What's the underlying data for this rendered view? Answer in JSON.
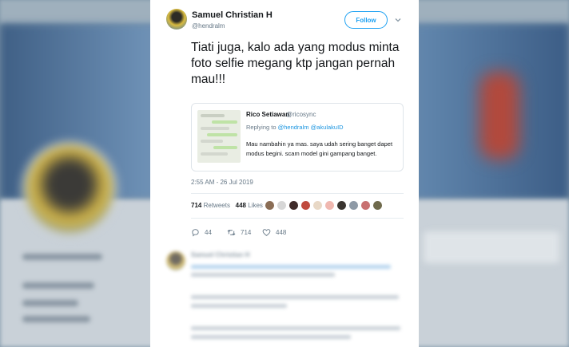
{
  "tweet": {
    "author_name": "Samuel Christian H",
    "author_handle": "@hendralm",
    "follow_label": "Follow",
    "text": "Tiati juga, kalo ada yang modus minta foto selfie megang ktp jangan pernah mau!!!",
    "timestamp": "2:55 AM - 26 Jul 2019",
    "retweets_count": "714",
    "retweets_label": "Retweets",
    "likes_count": "448",
    "likes_label": "Likes"
  },
  "quoted_tweet": {
    "name": "Rico Setiawan",
    "handle": "@ricosync",
    "replying_prefix": "Replying to",
    "mention_1": "@hendralm",
    "mention_2": "@akulakuID",
    "text": "Mau nambahin ya mas. saya udah sering banget dapet modus begini. scam model gini gampang banget."
  },
  "actions": {
    "replies": "44",
    "retweets": "714",
    "likes": "448"
  },
  "reply_preview": {
    "author_name": "Samuel Christian H"
  },
  "icons": {
    "reply": "reply-icon",
    "retweet": "retweet-icon",
    "like": "heart-icon",
    "more": "chevron-down-icon"
  },
  "colors": {
    "accent": "#1da1f2",
    "text": "#14171a",
    "muted": "#657786",
    "mention": "#1b95e0"
  }
}
